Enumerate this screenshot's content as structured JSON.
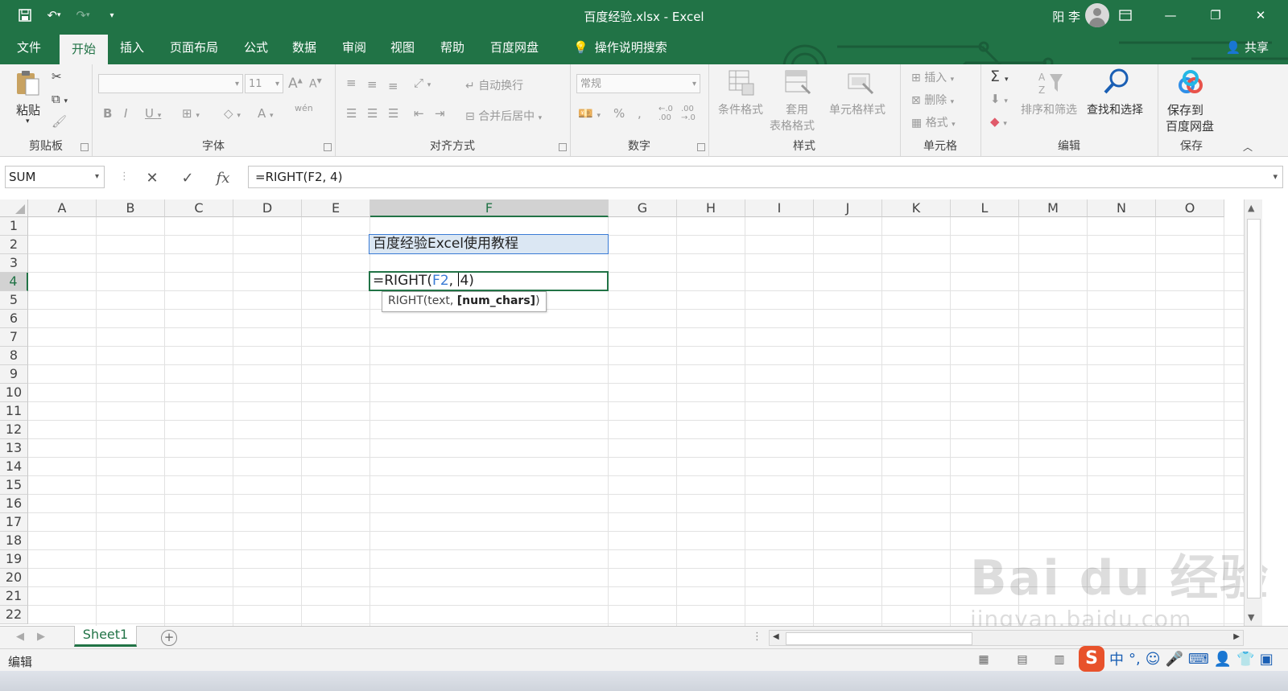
{
  "window": {
    "title": "百度经验.xlsx  -  Excel",
    "user": "阳 李",
    "colors": {
      "accent": "#217346",
      "ref_blue": "#3a7bd5"
    }
  },
  "qat": {
    "icons": [
      "save-icon",
      "undo-icon",
      "redo-icon",
      "customize-qat-icon"
    ]
  },
  "menu": {
    "tabs": [
      "文件",
      "开始",
      "插入",
      "页面布局",
      "公式",
      "数据",
      "审阅",
      "视图",
      "帮助",
      "百度网盘"
    ],
    "active": "开始",
    "tell_me": "操作说明搜索",
    "share": "共享"
  },
  "ribbon": {
    "clipboard": {
      "label": "剪贴板",
      "paste": "粘贴"
    },
    "font": {
      "label": "字体",
      "size": "11",
      "wen": "wén"
    },
    "alignment": {
      "label": "对齐方式",
      "wrap": "自动换行",
      "merge": "合并后居中"
    },
    "number": {
      "label": "数字",
      "format": "常规"
    },
    "styles": {
      "label": "样式",
      "conditional": "条件格式",
      "table_1": "套用",
      "table_2": "表格格式",
      "cell_styles": "单元格样式"
    },
    "cells": {
      "label": "单元格",
      "insert": "插入",
      "delete": "删除",
      "format": "格式"
    },
    "editing": {
      "label": "编辑",
      "sort": "排序和筛选",
      "find": "查找和选择"
    },
    "save": {
      "label": "保存",
      "line1": "保存到",
      "line2": "百度网盘"
    }
  },
  "formula_bar": {
    "name_box": "SUM",
    "formula": "=RIGHT(F2, 4)"
  },
  "grid": {
    "columns": [
      "A",
      "B",
      "C",
      "D",
      "E",
      "F",
      "G",
      "H",
      "I",
      "J",
      "K",
      "L",
      "M",
      "N",
      "O"
    ],
    "selected_column": "F",
    "rows": [
      "1",
      "2",
      "3",
      "4",
      "5",
      "6",
      "7",
      "8",
      "9",
      "10",
      "11",
      "12",
      "13",
      "14",
      "15",
      "16",
      "17",
      "18",
      "19",
      "20",
      "21",
      "22"
    ],
    "selected_row": "4",
    "cell_F2": "百度经验Excel使用教程",
    "cell_F4": {
      "prefix": "=RIGHT(",
      "ref": "F2",
      "after_ref": ", ",
      "rest": "4)"
    },
    "tooltip": {
      "fn": "RIGHT(text, ",
      "arg": "[num_chars]",
      "end": ")"
    }
  },
  "sheets": {
    "tabs": [
      "Sheet1"
    ],
    "active": "Sheet1"
  },
  "status": {
    "mode": "编辑"
  },
  "ime": {
    "lang": "中"
  },
  "watermark": {
    "line1": "Bai du 经验",
    "line2": "jingyan.baidu.com"
  }
}
